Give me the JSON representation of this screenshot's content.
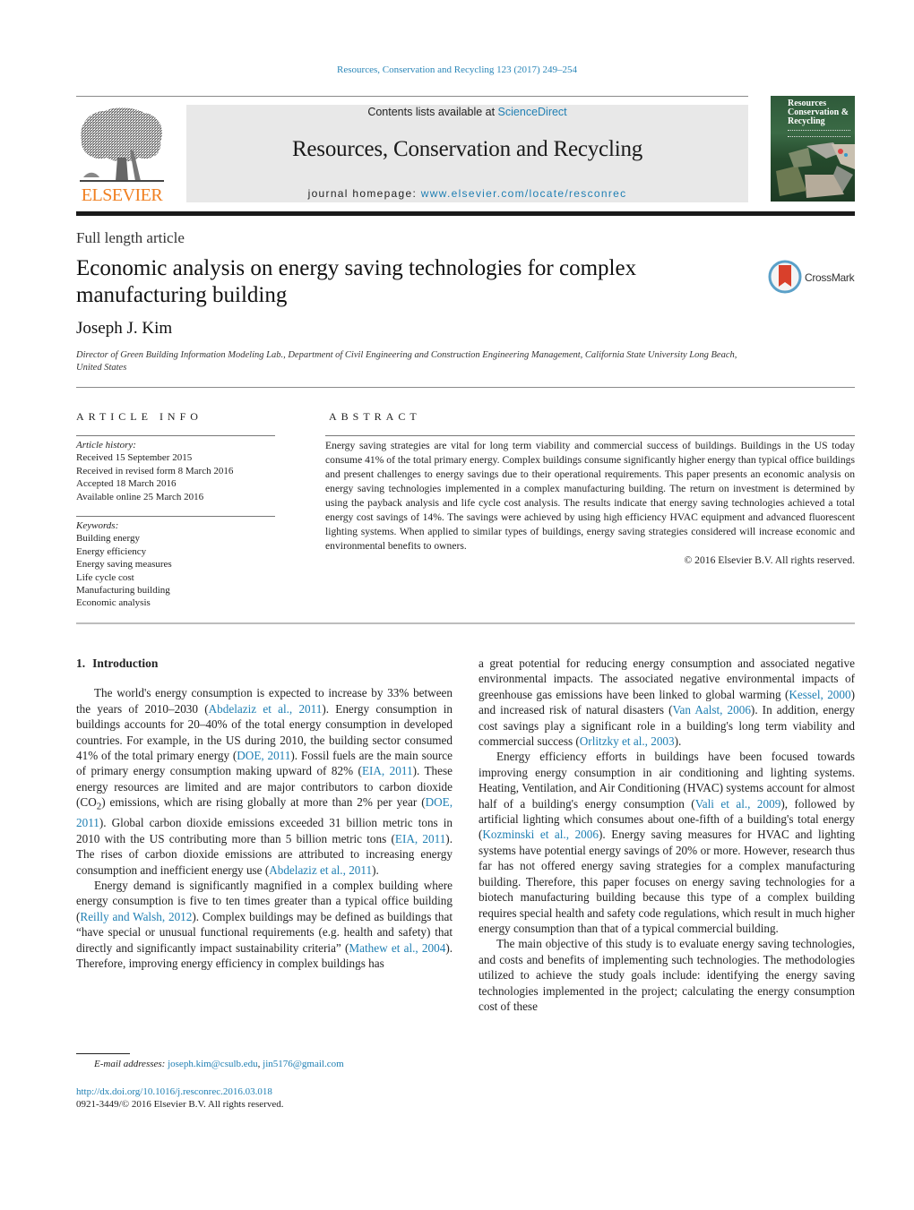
{
  "header": {
    "citation": "Resources, Conservation and Recycling 123 (2017) 249–254",
    "contents_prefix": "Contents lists available at ",
    "contents_link": "ScienceDirect",
    "journal_name": "Resources, Conservation and Recycling",
    "homepage_prefix": "journal homepage: ",
    "homepage_url": "www.elsevier.com/locate/resconrec",
    "publisher_wordmark": "ELSEVIER",
    "cover_title_lines": [
      "Resources",
      "Conservation &",
      "Recycling"
    ],
    "colors": {
      "link": "#1f7fb3",
      "elsevier_orange": "#f07f20",
      "masthead_bg": "#e8e8e8",
      "cover_green": "#2f5a3a"
    }
  },
  "article": {
    "type": "Full length article",
    "title": "Economic analysis on energy saving technologies for complex manufacturing building",
    "crossmark_label": "CrossMark",
    "author": "Joseph J. Kim",
    "affiliation": "Director of Green Building Information Modeling Lab., Department of Civil Engineering and Construction Engineering Management, California State University Long Beach, United States"
  },
  "article_info": {
    "heading": "ARTICLE INFO",
    "history_label": "Article history:",
    "history": [
      "Received 15 September 2015",
      "Received in revised form 8 March 2016",
      "Accepted 18 March 2016",
      "Available online 25 March 2016"
    ],
    "keywords_label": "Keywords:",
    "keywords": [
      "Building energy",
      "Energy efficiency",
      "Energy saving measures",
      "Life cycle cost",
      "Manufacturing building",
      "Economic analysis"
    ]
  },
  "abstract": {
    "heading": "ABSTRACT",
    "text": "Energy saving strategies are vital for long term viability and commercial success of buildings. Buildings in the US today consume 41% of the total primary energy. Complex buildings consume significantly higher energy than typical office buildings and present challenges to energy savings due to their operational requirements. This paper presents an economic analysis on energy saving technologies implemented in a complex manufacturing building. The return on investment is determined by using the payback analysis and life cycle cost analysis. The results indicate that energy saving technologies achieved a total energy cost savings of 14%. The savings were achieved by using high efficiency HVAC equipment and advanced fluorescent lighting systems. When applied to similar types of buildings, energy saving strategies considered will increase economic and environmental benefits to owners.",
    "copyright": "© 2016 Elsevier B.V. All rights reserved."
  },
  "body": {
    "section_number": "1.",
    "section_title": "Introduction",
    "p1": [
      {
        "t": "The world's energy consumption is expected to increase by 33% between the years of 2010–2030 ("
      },
      {
        "ref": "Abdelaziz et al., 2011"
      },
      {
        "t": "). Energy consumption in buildings accounts for 20–40% of the total energy consumption in developed countries. For example, in the US during 2010, the building sector consumed 41% of the total primary energy ("
      },
      {
        "ref": "DOE, 2011"
      },
      {
        "t": "). Fossil fuels are the main source of primary energy consumption making upward of 82% ("
      },
      {
        "ref": "EIA, 2011"
      },
      {
        "t": "). These energy resources are limited and are major contributors to carbon dioxide (CO"
      },
      {
        "sub": "2"
      },
      {
        "t": ") emissions, which are rising globally at more than 2% per year ("
      },
      {
        "ref": "DOE, 2011"
      },
      {
        "t": "). Global carbon dioxide emissions exceeded 31 billion metric tons in 2010 with the US contributing more than 5 billion metric tons ("
      },
      {
        "ref": "EIA, 2011"
      },
      {
        "t": "). The rises of carbon dioxide emissions are attributed to increasing energy consumption and inefficient energy use ("
      },
      {
        "ref": "Abdelaziz et al., 2011"
      },
      {
        "t": ")."
      }
    ],
    "p2": [
      {
        "t": "Energy demand is significantly magnified in a complex building where energy consumption is five to ten times greater than a typical office building ("
      },
      {
        "ref": "Reilly and Walsh, 2012"
      },
      {
        "t": "). Complex buildings may be defined as buildings that “have special or unusual functional requirements (e.g. health and safety) that directly and significantly impact sustainability criteria” ("
      },
      {
        "ref": "Mathew et al., 2004"
      },
      {
        "t": "). Therefore, improving energy efficiency in complex buildings has a great potential for reducing energy consumption and associated negative environmental impacts. The associated negative environmental impacts of greenhouse gas emissions have been linked to global warming ("
      },
      {
        "ref": "Kessel, 2000"
      },
      {
        "t": ") and increased risk of natural disasters ("
      },
      {
        "ref": "Van Aalst, 2006"
      },
      {
        "t": "). In addition, energy cost savings play a significant role in a building's long term viability and commercial success ("
      },
      {
        "ref": "Orlitzky et al., 2003"
      },
      {
        "t": ")."
      }
    ],
    "p3": [
      {
        "t": "Energy efficiency efforts in buildings have been focused towards improving energy consumption in air conditioning and lighting systems. Heating, Ventilation, and Air Conditioning (HVAC) systems account for almost half of a building's energy consumption ("
      },
      {
        "ref": "Vali et al., 2009"
      },
      {
        "t": "), followed by artificial lighting which consumes about one-fifth of a building's total energy ("
      },
      {
        "ref": "Kozminski et al., 2006"
      },
      {
        "t": "). Energy saving measures for HVAC and lighting systems have potential energy savings of 20% or more. However, research thus far has not offered energy saving strategies for a complex manufacturing building. Therefore, this paper focuses on energy saving technologies for a biotech manufacturing building because this type of a complex building requires special health and safety code regulations, which result in much higher energy consumption than that of a typical commercial building."
      }
    ],
    "p4": [
      {
        "t": "The main objective of this study is to evaluate energy saving technologies, and costs and benefits of implementing such technologies. The methodologies utilized to achieve the study goals include: identifying the energy saving technologies implemented in the project; calculating the energy consumption cost of these"
      }
    ]
  },
  "footer": {
    "email_label": "E-mail addresses:",
    "emails": [
      "joseph.kim@csulb.edu",
      "jin5176@gmail.com"
    ],
    "doi": "http://dx.doi.org/10.1016/j.resconrec.2016.03.018",
    "issn_line": "0921-3449/© 2016 Elsevier B.V. All rights reserved."
  }
}
